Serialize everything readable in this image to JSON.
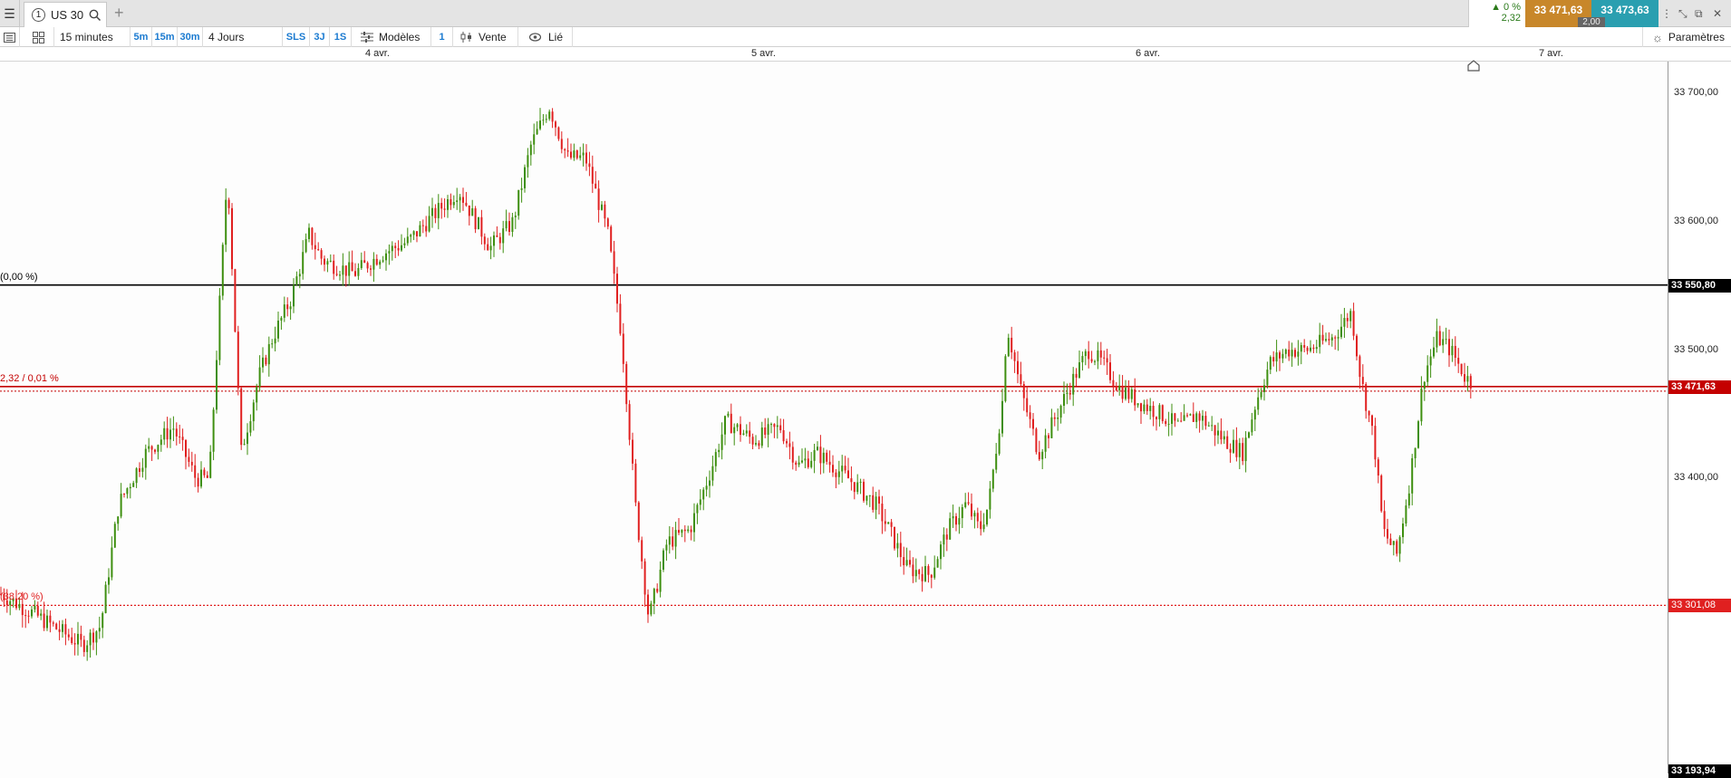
{
  "topbar": {
    "tab_number": "1",
    "tab_title": "US 30",
    "quote_pct": "▲ 0 %",
    "quote_change": "2,32",
    "bid": "33 471,63",
    "ask": "33 473,63",
    "spread": "2,00"
  },
  "toolbar": {
    "interval": "15 minutes",
    "preset_5m": "5m",
    "preset_15m": "15m",
    "preset_30m": "30m",
    "period": "4 Jours",
    "sls": "SLS",
    "p3j": "3J",
    "p1s": "1S",
    "templates": "Modèles",
    "count": "1",
    "order_side": "Vente",
    "linked": "Lié",
    "settings": "Paramètres"
  },
  "colors": {
    "up": "#3e8f10",
    "down": "#e02020",
    "current_price": "#c40000",
    "reference_line": "#000000"
  },
  "chart_data": {
    "type": "candlestick",
    "instrument": "US 30",
    "interval": "15 minutes",
    "x_ticks": [
      "4 avr.",
      "5 avr.",
      "6 avr.",
      "7 avr."
    ],
    "y_ticks": [
      "33 700,00",
      "33 600,00",
      "33 500,00",
      "33 400,00"
    ],
    "ylim": [
      33170,
      33725
    ],
    "lines": [
      {
        "price": 33550.8,
        "label": "33 550,80",
        "annotation": "(0,00 %)",
        "style": "solid",
        "color": "#000000"
      },
      {
        "price": 33471.63,
        "label": "33 471,63",
        "annotation": "2,32 / 0,01 %",
        "style": "solid",
        "color": "#c40000"
      },
      {
        "price": 33301.08,
        "label": "33 301,08",
        "annotation": "(38,20 %)",
        "style": "dotted",
        "color": "#e02020"
      }
    ],
    "bottom_label": "33 193,94",
    "path": [
      [
        0,
        33310
      ],
      [
        35,
        33295
      ],
      [
        90,
        33270
      ],
      [
        110,
        33285
      ],
      [
        130,
        33380
      ],
      [
        160,
        33420
      ],
      [
        190,
        33440
      ],
      [
        215,
        33400
      ],
      [
        230,
        33400
      ],
      [
        250,
        33640
      ],
      [
        265,
        33420
      ],
      [
        285,
        33480
      ],
      [
        300,
        33510
      ],
      [
        320,
        33540
      ],
      [
        340,
        33590
      ],
      [
        355,
        33570
      ],
      [
        390,
        33560
      ],
      [
        420,
        33575
      ],
      [
        450,
        33585
      ],
      [
        470,
        33600
      ],
      [
        505,
        33625
      ],
      [
        540,
        33580
      ],
      [
        565,
        33600
      ],
      [
        585,
        33660
      ],
      [
        605,
        33690
      ],
      [
        625,
        33650
      ],
      [
        645,
        33650
      ],
      [
        670,
        33590
      ],
      [
        685,
        33510
      ],
      [
        700,
        33380
      ],
      [
        715,
        33290
      ],
      [
        735,
        33350
      ],
      [
        760,
        33360
      ],
      [
        785,
        33410
      ],
      [
        800,
        33445
      ],
      [
        830,
        33430
      ],
      [
        860,
        33440
      ],
      [
        880,
        33410
      ],
      [
        900,
        33420
      ],
      [
        935,
        33400
      ],
      [
        965,
        33380
      ],
      [
        980,
        33360
      ],
      [
        1000,
        33330
      ],
      [
        1025,
        33325
      ],
      [
        1045,
        33360
      ],
      [
        1065,
        33380
      ],
      [
        1080,
        33360
      ],
      [
        1090,
        33380
      ],
      [
        1105,
        33460
      ],
      [
        1110,
        33520
      ],
      [
        1125,
        33470
      ],
      [
        1145,
        33420
      ],
      [
        1165,
        33450
      ],
      [
        1185,
        33480
      ],
      [
        1200,
        33500
      ],
      [
        1215,
        33490
      ],
      [
        1235,
        33470
      ],
      [
        1255,
        33460
      ],
      [
        1280,
        33450
      ],
      [
        1300,
        33440
      ],
      [
        1320,
        33450
      ],
      [
        1350,
        33430
      ],
      [
        1370,
        33420
      ],
      [
        1385,
        33460
      ],
      [
        1400,
        33490
      ],
      [
        1420,
        33500
      ],
      [
        1440,
        33500
      ],
      [
        1470,
        33510
      ],
      [
        1490,
        33530
      ],
      [
        1500,
        33480
      ],
      [
        1515,
        33430
      ],
      [
        1525,
        33360
      ],
      [
        1540,
        33340
      ],
      [
        1555,
        33400
      ],
      [
        1570,
        33480
      ],
      [
        1585,
        33510
      ],
      [
        1600,
        33500
      ],
      [
        1615,
        33480
      ],
      [
        1622,
        33475
      ]
    ],
    "candle_spacing": 3.4
  }
}
